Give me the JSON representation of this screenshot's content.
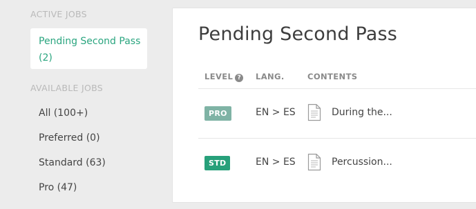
{
  "sidebar": {
    "active_title": "ACTIVE JOBS",
    "active_item": "Pending Second Pass (2)",
    "available_title": "AVAILABLE JOBS",
    "items": [
      {
        "label": "All (100+)"
      },
      {
        "label": "Preferred (0)"
      },
      {
        "label": "Standard (63)"
      },
      {
        "label": "Pro (47)"
      }
    ]
  },
  "main": {
    "title": "Pending Second Pass",
    "headers": {
      "level": "LEVEL",
      "lang": "LANG.",
      "contents": "CONTENTS"
    },
    "help_glyph": "?",
    "rows": [
      {
        "level": "PRO",
        "level_color": "#7fb3a5",
        "lang": "EN > ES",
        "contents": "During the..."
      },
      {
        "level": "STD",
        "level_color": "#27a07a",
        "lang": "EN > ES",
        "contents": "Percussion..."
      }
    ]
  },
  "icons": {
    "help": "question-circle-icon",
    "document": "document-icon"
  },
  "colors": {
    "accent": "#2aa57f",
    "background": "#ececec"
  }
}
